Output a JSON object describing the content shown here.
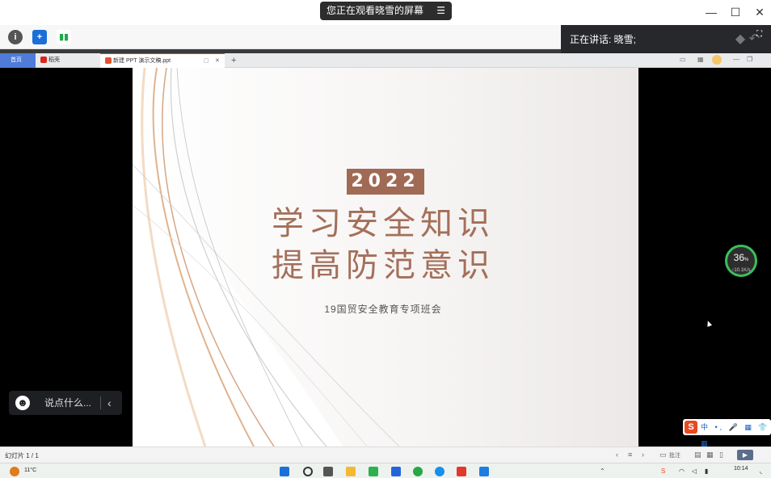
{
  "meeting": {
    "share_banner": "您正在观看晓雪的屏幕",
    "speaking_label": "正在讲话: 晓雪;"
  },
  "tabs": [
    {
      "label": "首页"
    },
    {
      "label": "稻壳"
    },
    {
      "label": "新建 PPT 演示文稿.ppt"
    }
  ],
  "slide": {
    "year": "2022",
    "title_line1": "学习安全知识",
    "title_line2": "提高防范意识",
    "subtitle": "19国贸安全教育专项班会"
  },
  "comment": {
    "placeholder": "说点什么..."
  },
  "network": {
    "percent": "36",
    "percent_unit": "%",
    "rate": "↑10.1K/s"
  },
  "ime": {
    "items": "中 •, 🎤 ▦ 👕 ▦"
  },
  "statusbar": {
    "slide_counter": "幻灯片 1 / 1",
    "notes_label": "批注"
  },
  "taskbar": {
    "temperature": "11°C",
    "time": "10:14"
  },
  "colors": {
    "accent_brown": "#a46f5a",
    "badge_bg": "#a06a54",
    "home_tab": "#4f7cd9",
    "speed_ring": "#3cbf5a"
  }
}
